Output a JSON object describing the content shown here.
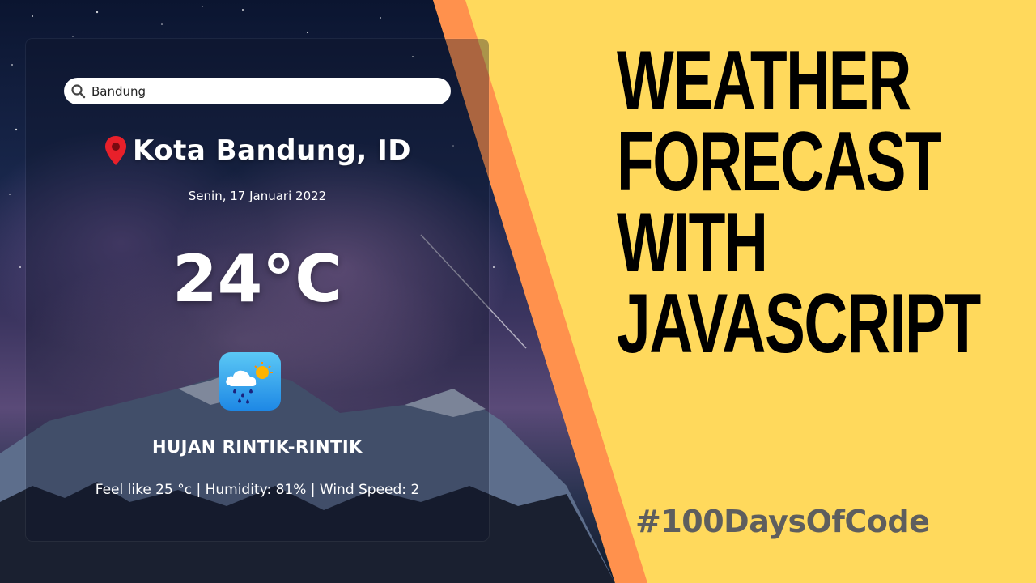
{
  "search": {
    "value": "Bandung",
    "icon": "search-icon"
  },
  "location": {
    "city": "Kota Bandung, ID",
    "icon": "location-pin-icon",
    "pin_color": "#e8202a"
  },
  "date": "Senin, 17 Januari 2022",
  "temperature": "24°C",
  "condition": {
    "icon": "rain-sun-cloud-icon",
    "description": "HUJAN RINTIK-RINTIK"
  },
  "details": "Feel like 25 °c | Humidity: 81% | Wind Speed: 2",
  "headline": {
    "line1": "WEATHER",
    "line2": "FORECAST",
    "line3": "WITH",
    "line4": "JAVASCRIPT"
  },
  "hashtag": "#100DaysOfCode",
  "colors": {
    "background": "#ffd95c",
    "stripe": "#ff914d",
    "headline": "#000000",
    "hashtag": "#5e5e5e"
  }
}
